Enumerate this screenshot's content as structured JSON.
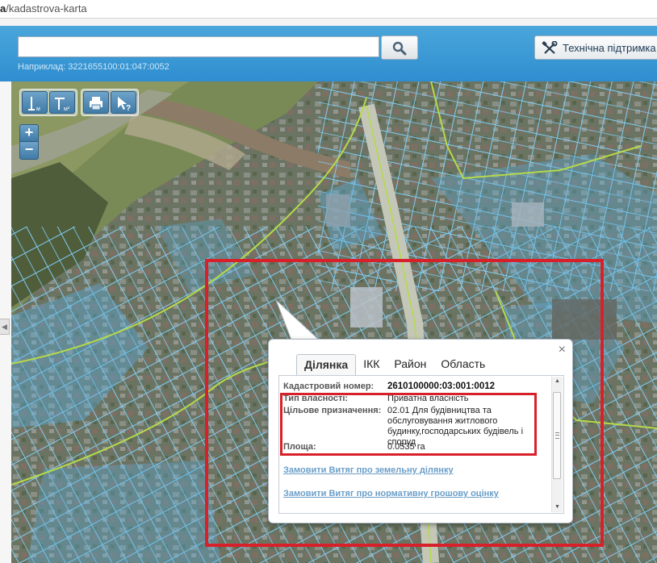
{
  "browser": {
    "url_prefix": "/kadastrova-karta",
    "url_visible_fragment": "a"
  },
  "header": {
    "search_placeholder": "",
    "search_hint": "Наприклад: 3221655100:01:047:0052",
    "support_label": "Технічна підтримка"
  },
  "toolbar": {
    "measure_length_unit": "м",
    "measure_area_unit": "м²"
  },
  "zoom": {
    "plus": "+",
    "minus": "−"
  },
  "popup": {
    "close": "×",
    "tabs": [
      {
        "label": "Ділянка",
        "active": true
      },
      {
        "label": "ІКК",
        "active": false
      },
      {
        "label": "Район",
        "active": false
      },
      {
        "label": "Область",
        "active": false
      }
    ],
    "fields": {
      "cadastral_label": "Кадастровий номер:",
      "cadastral_value": "2610100000:03:001:0012",
      "ownership_label": "Тип власності:",
      "ownership_value": "Приватна власність",
      "purpose_label": "Цільове призначення:",
      "purpose_value": "02.01 Для будівництва та обслуговування житлового будинку,господарських будівель і споруд",
      "area_label": "Площа:",
      "area_value": "0.0535 га"
    },
    "links": {
      "order_land_extract": "Замовити Витяг про земельну ділянку",
      "order_valuation_extract": "Замовити Витяг про нормативну грошову оцінку"
    }
  },
  "colors": {
    "header": "#3a99d4",
    "highlight": "#d8202a",
    "parcel_line": "#6fc3f0",
    "boundary_line": "#b6d94a",
    "link": "#6a9ec8"
  }
}
